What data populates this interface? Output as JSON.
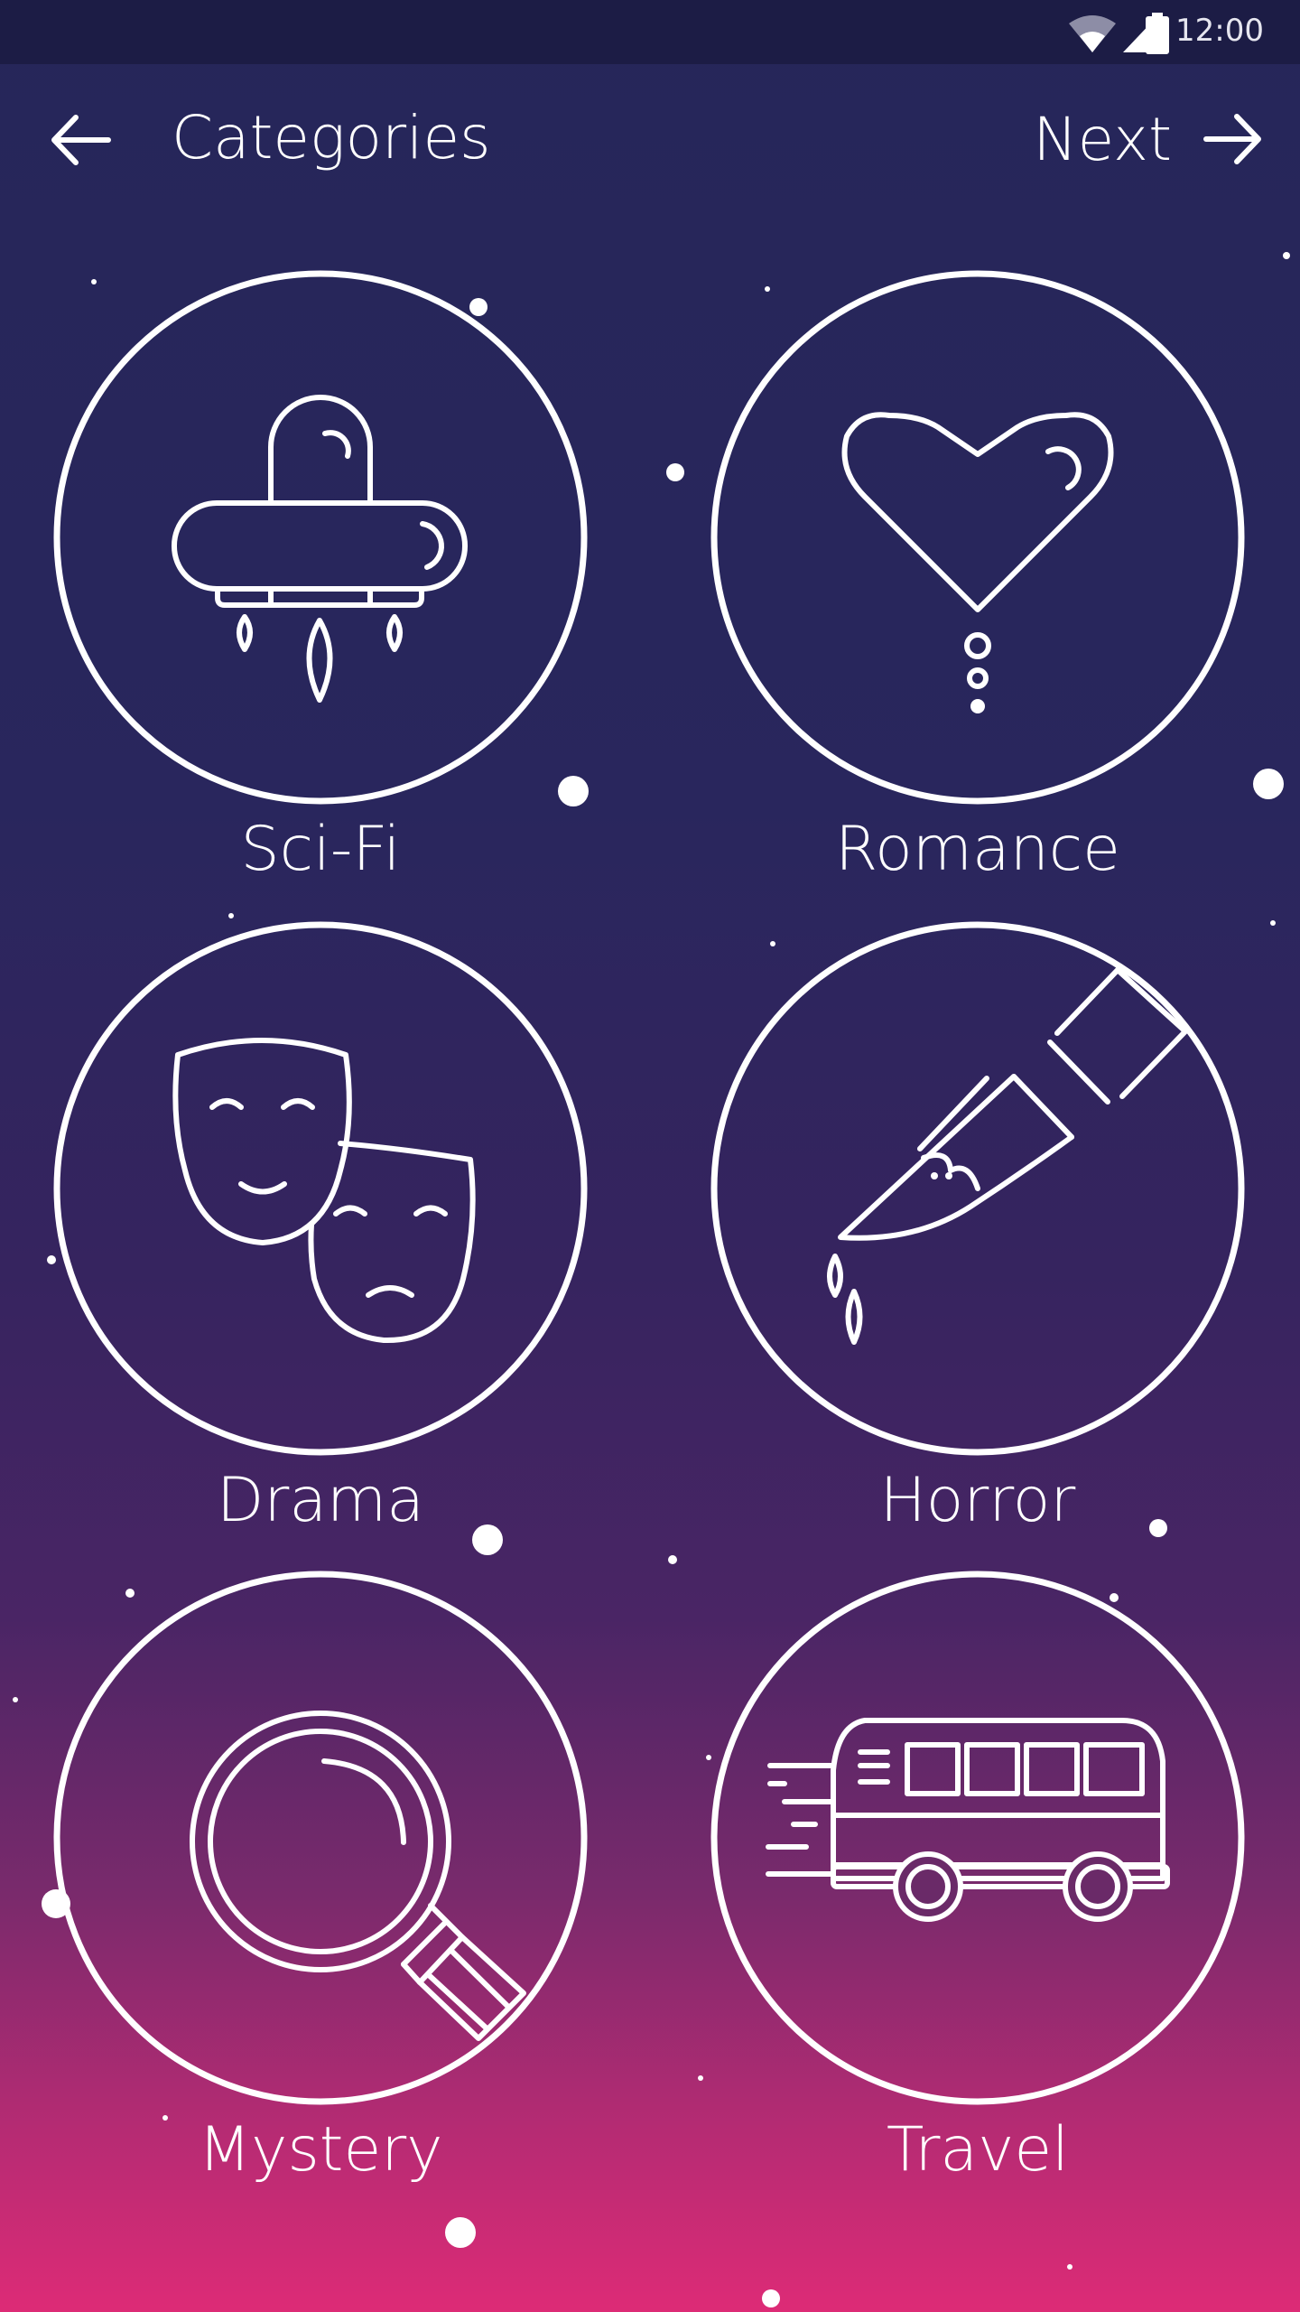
{
  "status_bar": {
    "time": "12:00",
    "icons": [
      "wifi-icon",
      "cell-signal-icon",
      "battery-icon"
    ]
  },
  "header": {
    "title": "Categories",
    "next_label": "Next",
    "back_icon": "arrow-left-icon",
    "next_icon": "arrow-right-icon"
  },
  "categories": [
    {
      "label": "Sci-Fi",
      "icon": "ufo-icon"
    },
    {
      "label": "Romance",
      "icon": "heart-icon"
    },
    {
      "label": "Drama",
      "icon": "theater-masks-icon"
    },
    {
      "label": "Horror",
      "icon": "bloody-knife-icon"
    },
    {
      "label": "Mystery",
      "icon": "magnifying-glass-icon"
    },
    {
      "label": "Travel",
      "icon": "bus-icon"
    }
  ],
  "colors": {
    "background_top": "#262659",
    "background_bottom": "#dd2b76",
    "foreground": "#ffffff"
  }
}
